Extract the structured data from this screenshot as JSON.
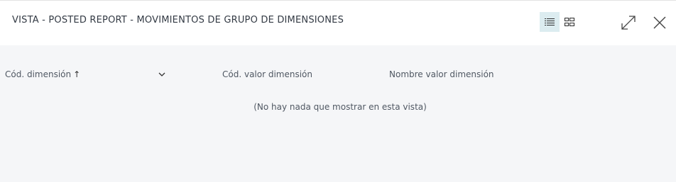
{
  "header": {
    "title": "VISTA - POSTED REPORT - MOVIMIENTOS DE GRUPO DE DIMENSIONES",
    "list_view_icon": "list-icon",
    "tile_view_icon": "tile-grid-icon",
    "expand_icon": "expand-icon",
    "close_icon": "close-icon"
  },
  "table": {
    "columns": [
      {
        "label": "Cód. dimensión",
        "sort": "↑"
      },
      {
        "label": "Cód. valor dimensión"
      },
      {
        "label": "Nombre valor dimensión"
      }
    ],
    "empty_message": "(No hay nada que mostrar en esta vista)"
  },
  "colors": {
    "header_bg": "#ffffff",
    "content_bg": "#f5f6f8",
    "active_view_bg": "#dcecf0",
    "text": "#333a44"
  }
}
